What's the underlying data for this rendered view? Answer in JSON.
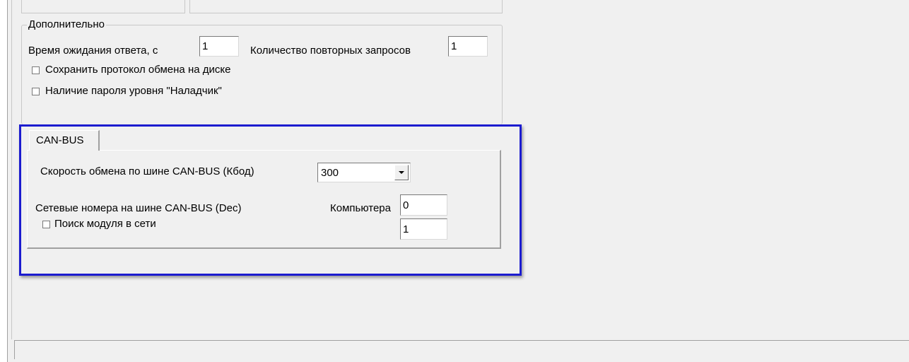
{
  "group": {
    "title": "Дополнительно",
    "timeout_label": "Время ожидания ответа, с",
    "timeout_value": "1",
    "retries_label": "Количество повторных запросов",
    "retries_value": "1",
    "save_log_label": "Сохранить протокол обмена на диске",
    "password_label": "Наличие пароля уровня \"Наладчик\""
  },
  "tabs": {
    "active": "CAN-BUS"
  },
  "canbus": {
    "speed_label": "Скорость обмена по шине CAN-BUS (Кбод)",
    "speed_value": "300",
    "netnum_label": "Сетевые номера на шине CAN-BUS (Dec)",
    "computer_label": "Компьютера",
    "computer_value": "0",
    "module_value": "1",
    "search_label": "Поиск модуля в сети"
  },
  "highlight_color": "#1c1ccf"
}
